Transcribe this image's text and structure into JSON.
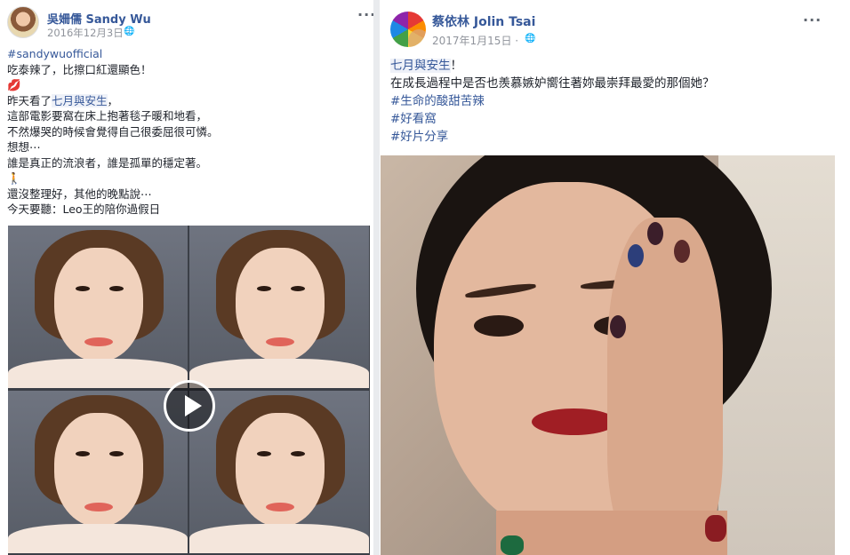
{
  "left_post": {
    "author": "吳姍儒 Sandy Wu",
    "date": "2016年12月3日 · ",
    "audience_icon": "globe-icon",
    "more": "···",
    "hashtag": "#sandywuofficial",
    "lines": [
      "吃泰辣了，比擦口紅還顯色！",
      "💋",
      "昨天看了",
      "七月與安生",
      "，",
      "這部電影要窩在床上抱著毯子暖和地看，",
      "不然爆哭的時候會覺得自己很委屈很可憐。",
      "想想⋯",
      "誰是真正的流浪者，誰是孤單的穩定著。",
      "🚶",
      "還沒整理好，其他的晚點說⋯",
      "今天要聽：Leo王的陪你過假日"
    ],
    "video_play_icon": "play-icon"
  },
  "right_post": {
    "author": "蔡依林 Jolin Tsai",
    "date": "2017年1月15日 · ",
    "audience_icon": "globe-icon",
    "more": "···",
    "title_link": "七月與安生",
    "title_suffix": "！",
    "body": "在成長過程中是否也羨慕嫉妒嚮往著妳最崇拜最愛的那個她？",
    "hashtags": [
      "#生命的酸甜苦辣",
      "#好看窩",
      "#好片分享"
    ]
  },
  "colors": {
    "link": "#365899",
    "meta": "#90949c",
    "text": "#1d2129"
  }
}
